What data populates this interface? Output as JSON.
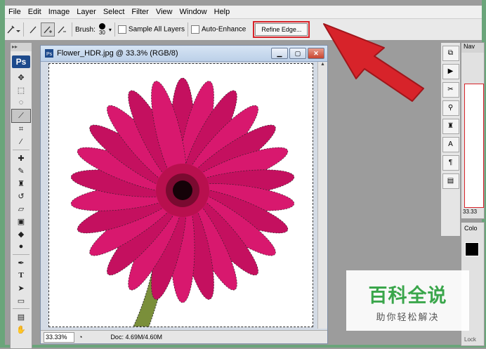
{
  "menu": [
    "File",
    "Edit",
    "Image",
    "Layer",
    "Select",
    "Filter",
    "View",
    "Window",
    "Help"
  ],
  "options": {
    "brush_label": "Brush:",
    "brush_size": "30",
    "sample_all_layers": "Sample All Layers",
    "auto_enhance": "Auto-Enhance",
    "refine_edge": "Refine Edge..."
  },
  "toolbox": {
    "logo": "Ps"
  },
  "document": {
    "title": "Flower_HDR.jpg @ 33.3% (RGB/8)",
    "zoom": "33.33%",
    "doc_size": "Doc: 4.69M/4.60M"
  },
  "panels": {
    "nav_tab": "Nav",
    "nav_zoom": "33.33",
    "color_tab": "Colo",
    "lock": "Lock"
  },
  "watermark": {
    "title": "百科全说",
    "subtitle": "助你轻松解决"
  },
  "colors": {
    "highlight": "#d7232a",
    "flower": "#d8186e",
    "watermark": "#3aa64b"
  }
}
